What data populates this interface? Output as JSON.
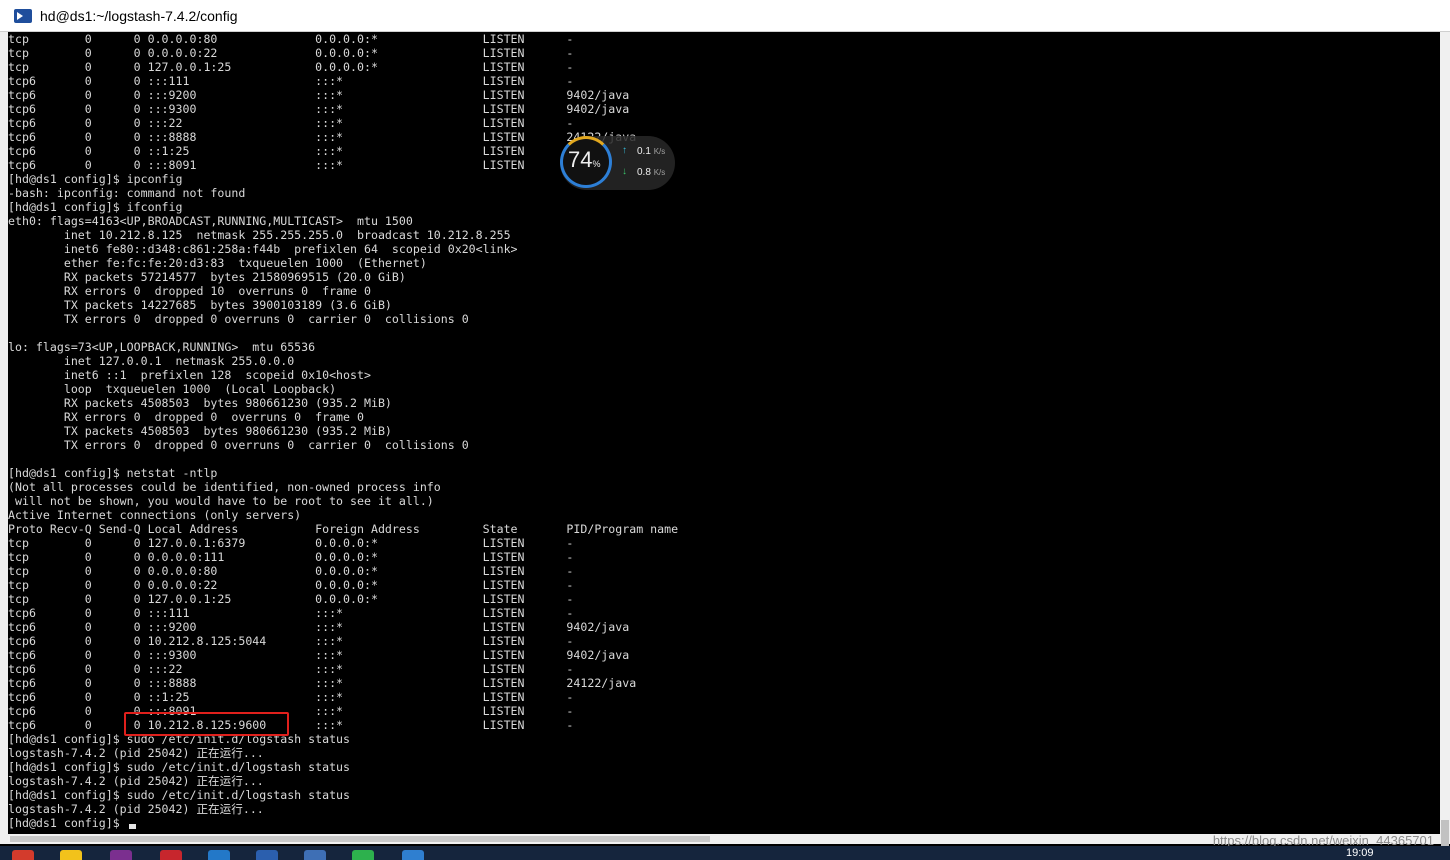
{
  "window": {
    "title": "hd@ds1:~/logstash-7.4.2/config"
  },
  "terminal": {
    "lines": [
      "tcp        0      0 0.0.0.0:80              0.0.0.0:*               LISTEN      -",
      "tcp        0      0 0.0.0.0:22              0.0.0.0:*               LISTEN      -",
      "tcp        0      0 127.0.0.1:25            0.0.0.0:*               LISTEN      -",
      "tcp6       0      0 :::111                  :::*                    LISTEN      -",
      "tcp6       0      0 :::9200                 :::*                    LISTEN      9402/java",
      "tcp6       0      0 :::9300                 :::*                    LISTEN      9402/java",
      "tcp6       0      0 :::22                   :::*                    LISTEN      -",
      "tcp6       0      0 :::8888                 :::*                    LISTEN      24122/java",
      "tcp6       0      0 ::1:25                  :::*                    LISTEN      -",
      "tcp6       0      0 :::8091                 :::*                    LISTEN      -",
      "[hd@ds1 config]$ ipconfig",
      "-bash: ipconfig: command not found",
      "[hd@ds1 config]$ ifconfig",
      "eth0: flags=4163<UP,BROADCAST,RUNNING,MULTICAST>  mtu 1500",
      "        inet 10.212.8.125  netmask 255.255.255.0  broadcast 10.212.8.255",
      "        inet6 fe80::d348:c861:258a:f44b  prefixlen 64  scopeid 0x20<link>",
      "        ether fe:fc:fe:20:d3:83  txqueuelen 1000  (Ethernet)",
      "        RX packets 57214577  bytes 21580969515 (20.0 GiB)",
      "        RX errors 0  dropped 10  overruns 0  frame 0",
      "        TX packets 14227685  bytes 3900103189 (3.6 GiB)",
      "        TX errors 0  dropped 0 overruns 0  carrier 0  collisions 0",
      "",
      "lo: flags=73<UP,LOOPBACK,RUNNING>  mtu 65536",
      "        inet 127.0.0.1  netmask 255.0.0.0",
      "        inet6 ::1  prefixlen 128  scopeid 0x10<host>",
      "        loop  txqueuelen 1000  (Local Loopback)",
      "        RX packets 4508503  bytes 980661230 (935.2 MiB)",
      "        RX errors 0  dropped 0  overruns 0  frame 0",
      "        TX packets 4508503  bytes 980661230 (935.2 MiB)",
      "        TX errors 0  dropped 0 overruns 0  carrier 0  collisions 0",
      "",
      "[hd@ds1 config]$ netstat -ntlp",
      "(Not all processes could be identified, non-owned process info",
      " will not be shown, you would have to be root to see it all.)",
      "Active Internet connections (only servers)",
      "Proto Recv-Q Send-Q Local Address           Foreign Address         State       PID/Program name",
      "tcp        0      0 127.0.0.1:6379          0.0.0.0:*               LISTEN      -",
      "tcp        0      0 0.0.0.0:111             0.0.0.0:*               LISTEN      -",
      "tcp        0      0 0.0.0.0:80              0.0.0.0:*               LISTEN      -",
      "tcp        0      0 0.0.0.0:22              0.0.0.0:*               LISTEN      -",
      "tcp        0      0 127.0.0.1:25            0.0.0.0:*               LISTEN      -",
      "tcp6       0      0 :::111                  :::*                    LISTEN      -",
      "tcp6       0      0 :::9200                 :::*                    LISTEN      9402/java",
      "tcp6       0      0 10.212.8.125:5044       :::*                    LISTEN      -",
      "tcp6       0      0 :::9300                 :::*                    LISTEN      9402/java",
      "tcp6       0      0 :::22                   :::*                    LISTEN      -",
      "tcp6       0      0 :::8888                 :::*                    LISTEN      24122/java",
      "tcp6       0      0 ::1:25                  :::*                    LISTEN      -",
      "tcp6       0      0 :::8091                 :::*                    LISTEN      -",
      "tcp6       0      0 10.212.8.125:9600       :::*                    LISTEN      -",
      "[hd@ds1 config]$ sudo /etc/init.d/logstash status",
      "logstash-7.4.2 (pid 25042) 正在运行...",
      "[hd@ds1 config]$ sudo /etc/init.d/logstash status",
      "logstash-7.4.2 (pid 25042) 正在运行...",
      "[hd@ds1 config]$ sudo /etc/init.d/logstash status",
      "logstash-7.4.2 (pid 25042) 正在运行..."
    ],
    "prompt": "[hd@ds1 config]$ "
  },
  "net_widget": {
    "percent": "74",
    "percent_unit": "%",
    "upload": "0.1",
    "download": "0.8",
    "unit": "K/s"
  },
  "watermark": "https://blog.csdn.net/weixin_44365701",
  "taskbar": {
    "clock": "19:09"
  },
  "colors": {
    "terminal_bg": "#000000",
    "terminal_fg": "#d9d9d9",
    "highlight": "#e0201c"
  }
}
